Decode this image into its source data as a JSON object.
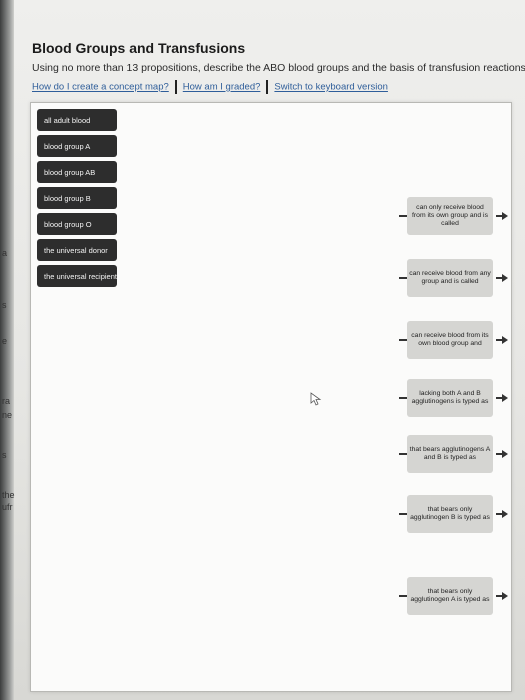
{
  "header": {
    "title": "Blood Groups and Transfusions",
    "instruction": "Using no more than 13 propositions, describe the ABO blood groups and the basis of transfusion reactions.",
    "links": [
      "How do I create a concept map?",
      "How am I graded?",
      "Switch to keyboard version"
    ]
  },
  "left_edge": [
    "a",
    "s",
    "e",
    "ra",
    "ne",
    "s",
    "the",
    "ufr"
  ],
  "concepts": [
    "all adult blood",
    "blood group A",
    "blood group AB",
    "blood group B",
    "blood group O",
    "the universal donor",
    "the universal recipient"
  ],
  "linking_phrases": [
    "can only receive blood from its own group and is called",
    "can receive blood from any group and is called",
    "can receive blood from its own blood group and",
    "lacking both A and B agglutinogens is typed as",
    "that bears agglutinogens A and B is typed as",
    "that bears only agglutinogen B is typed as",
    "that bears only agglutinogen A is typed as"
  ]
}
